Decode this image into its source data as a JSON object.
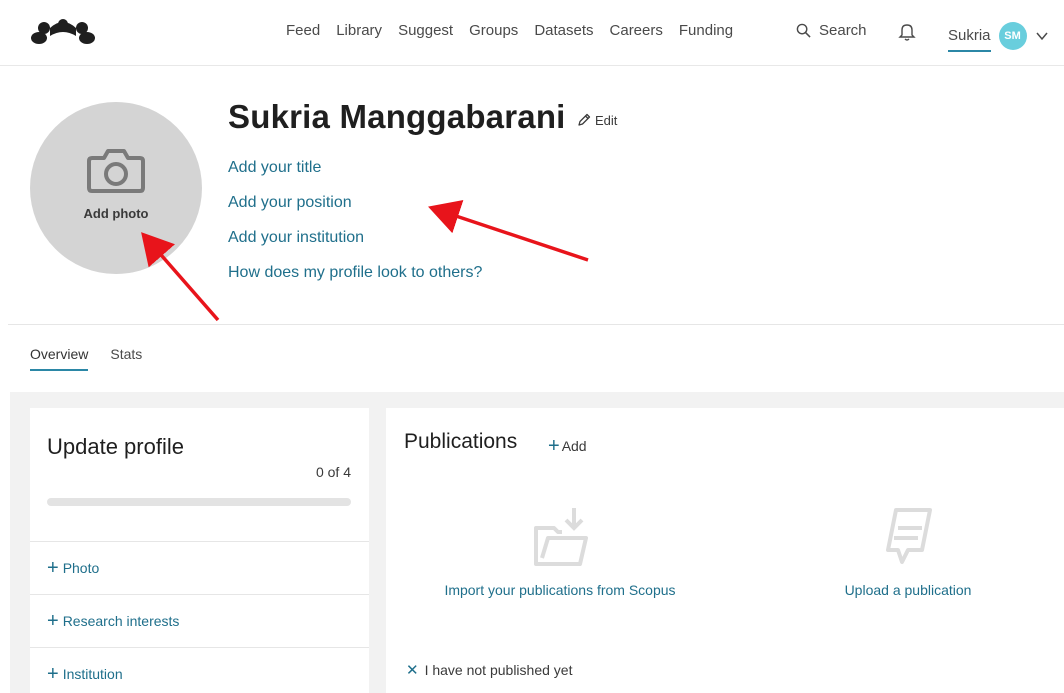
{
  "nav": {
    "items": [
      "Feed",
      "Library",
      "Suggest",
      "Groups",
      "Datasets",
      "Careers",
      "Funding"
    ],
    "search_label": "Search",
    "user_name": "Sukria",
    "user_initials": "SM"
  },
  "profile": {
    "name": "Sukria Manggabarani",
    "edit_label": "Edit",
    "add_photo_label": "Add photo",
    "links": [
      "Add your title",
      "Add your position",
      "Add your institution",
      "How does my profile look to others?"
    ]
  },
  "tabs": [
    {
      "label": "Overview",
      "active": true
    },
    {
      "label": "Stats",
      "active": false
    }
  ],
  "update_profile": {
    "title": "Update profile",
    "progress_text": "0 of 4",
    "progress_fraction": 0,
    "items": [
      "Photo",
      "Research interests",
      "Institution"
    ]
  },
  "publications": {
    "title": "Publications",
    "add_label": "Add",
    "import_label": "Import your publications from Scopus",
    "upload_label": "Upload a publication",
    "not_published_label": "I have not published yet"
  },
  "colors": {
    "accent": "#2b87a6",
    "link": "#1f6f8b",
    "avatar": "#69cedd",
    "annotation_arrow": "#e8141b"
  }
}
